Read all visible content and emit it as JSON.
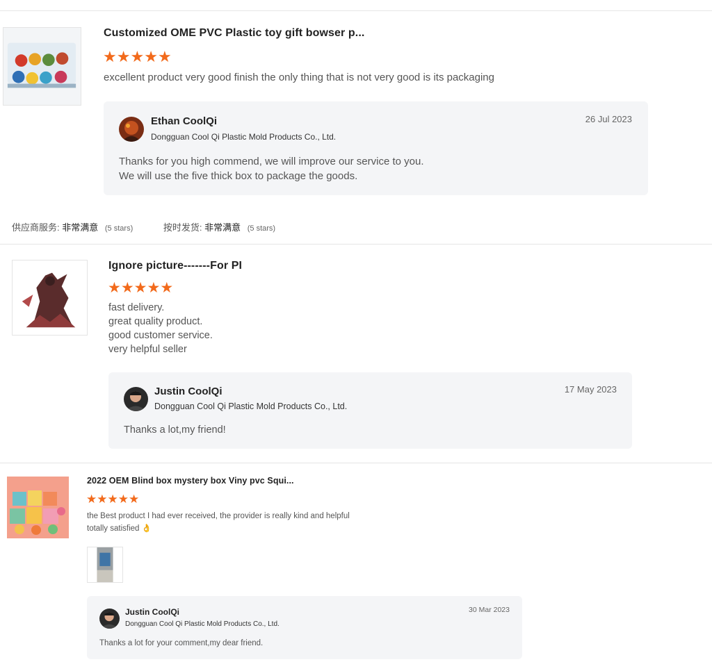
{
  "reviews": [
    {
      "title": "Customized OME PVC Plastic toy gift bowser p...",
      "rating": 5,
      "star_glyphs": [
        "★",
        "★",
        "★",
        "★",
        "★"
      ],
      "text_lines": [
        "excellent product very good finish the only thing that is not very good is its packaging"
      ],
      "reply": {
        "name": "Ethan CoolQi",
        "company": "Dongguan Cool Qi Plastic Mold Products Co., Ltd.",
        "date": "26 Jul 2023",
        "text_lines": [
          "Thanks for you high commend, we will improve our service to you.",
          "We will use the five thick box to package the goods."
        ]
      },
      "ratings": [
        {
          "label": "供应商服务:",
          "value": "非常满意",
          "note": "(5 stars)"
        },
        {
          "label": "按时发货:",
          "value": "非常满意",
          "note": "(5 stars)"
        }
      ]
    },
    {
      "title": "Ignore picture-------For PI",
      "rating": 5,
      "star_glyphs": [
        "★",
        "★",
        "★",
        "★",
        "★"
      ],
      "text_lines": [
        "fast delivery.",
        "great quality product.",
        "good customer service.",
        "very helpful seller"
      ],
      "reply": {
        "name": "Justin CoolQi",
        "company": "Dongguan Cool Qi Plastic Mold Products Co., Ltd.",
        "date": "17 May 2023",
        "text_lines": [
          "Thanks a lot,my friend!"
        ]
      }
    },
    {
      "title": "2022 OEM Blind box mystery box Viny pvc Squi...",
      "rating": 5,
      "star_glyphs": [
        "★",
        "★",
        "★",
        "★",
        "★"
      ],
      "text_lines": [
        "the Best product I had ever received, the provider is really kind and helpful",
        "totally satisfied 👌"
      ],
      "reply": {
        "name": "Justin CoolQi",
        "company": "Dongguan Cool Qi Plastic Mold Products Co., Ltd.",
        "date": "30 Mar 2023",
        "text_lines": [
          "Thanks a lot for your comment,my dear friend."
        ]
      }
    }
  ],
  "colors": {
    "star": "#f26a1b",
    "reply_bg": "#f4f5f7",
    "divider": "#e5e5e5"
  }
}
